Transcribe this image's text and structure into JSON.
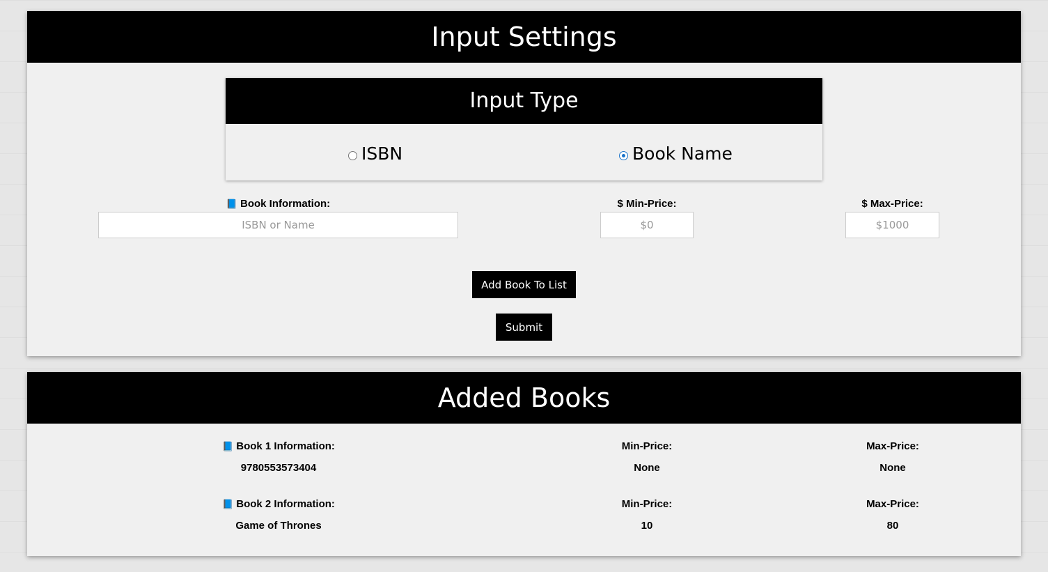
{
  "settings": {
    "title": "Input Settings",
    "input_type": {
      "title": "Input Type",
      "options": [
        {
          "label": "ISBN",
          "selected": false
        },
        {
          "label": "Book Name",
          "selected": true
        }
      ]
    },
    "book_info": {
      "label": "Book Information:",
      "placeholder": "ISBN or Name"
    },
    "min_price": {
      "label": "$ Min-Price:",
      "placeholder": "$0"
    },
    "max_price": {
      "label": "$ Max-Price:",
      "placeholder": "$1000"
    },
    "add_button": "Add Book To List",
    "submit_button": "Submit"
  },
  "added": {
    "title": "Added Books",
    "books": [
      {
        "info_label": "Book 1 Information:",
        "info": "9780553573404",
        "min_label": "Min-Price:",
        "min": "None",
        "max_label": "Max-Price:",
        "max": "None"
      },
      {
        "info_label": "Book 2 Information:",
        "info": "Game of Thrones",
        "min_label": "Min-Price:",
        "min": "10",
        "max_label": "Max-Price:",
        "max": "80"
      }
    ]
  },
  "icons": {
    "book": "book-icon"
  },
  "colors": {
    "header_bg": "#000000",
    "panel_bg": "#f0f0f0",
    "radio_accent": "#1a73c9"
  }
}
